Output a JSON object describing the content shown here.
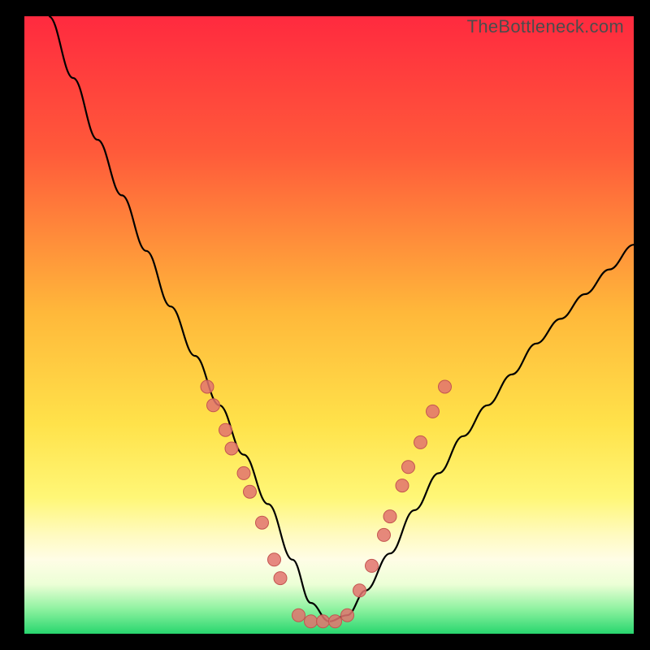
{
  "watermark": "TheBottleneck.com",
  "colors": {
    "frame": "#000000",
    "curve": "#000000",
    "marker_fill": "#e2736e",
    "marker_stroke": "#c35550",
    "gradient_top": "#ff2a3f",
    "gradient_mid1": "#ffd53a",
    "gradient_mid2": "#fff7a0",
    "gradient_band": "#fffde0",
    "gradient_bottom": "#33e07a"
  },
  "chart_data": {
    "type": "line",
    "title": "",
    "xlabel": "",
    "ylabel": "",
    "xlim": [
      0,
      100
    ],
    "ylim": [
      0,
      100
    ],
    "curve": {
      "comment": "y ≈ bottleneck percentage; x ≈ normalized component balance; curve drops steeply from left, bottoms near x=48, rises toward right with shallower slope",
      "x": [
        4,
        8,
        12,
        16,
        20,
        24,
        28,
        32,
        36,
        40,
        44,
        47,
        50,
        53,
        56,
        60,
        64,
        68,
        72,
        76,
        80,
        84,
        88,
        92,
        96,
        100
      ],
      "y": [
        100,
        90,
        80,
        71,
        62,
        53,
        45,
        37,
        29,
        21,
        12,
        5,
        2,
        3,
        7,
        13,
        20,
        26,
        32,
        37,
        42,
        47,
        51,
        55,
        59,
        63
      ]
    },
    "series": [
      {
        "name": "left-cluster",
        "x": [
          30,
          31,
          33,
          34,
          36,
          37,
          39,
          41,
          42
        ],
        "y": [
          40,
          37,
          33,
          30,
          26,
          23,
          18,
          12,
          9
        ]
      },
      {
        "name": "right-cluster",
        "x": [
          55,
          57,
          59,
          60,
          62,
          63,
          65,
          67,
          69
        ],
        "y": [
          7,
          11,
          16,
          19,
          24,
          27,
          31,
          36,
          40
        ]
      },
      {
        "name": "bottom-cluster",
        "x": [
          45,
          47,
          49,
          51,
          53
        ],
        "y": [
          3,
          2,
          2,
          2,
          3
        ]
      }
    ]
  }
}
